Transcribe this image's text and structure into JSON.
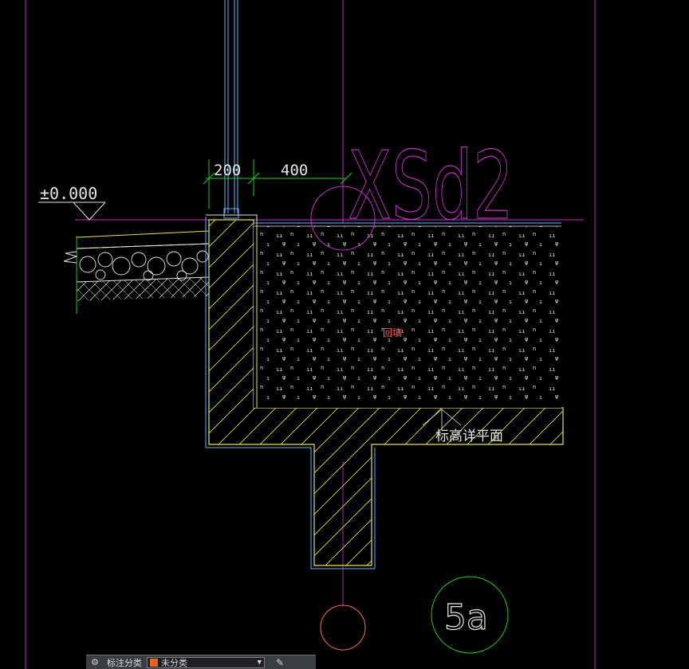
{
  "drawing": {
    "elevation_label": "±0.000",
    "dim_left": "200",
    "dim_right": "400",
    "section_tag": "XSd2",
    "backfill_label": "回填",
    "elevation_note": "标高详平面",
    "detail_number": "5a"
  },
  "statusbar": {
    "label": "标注分类",
    "selected_value": "未分类",
    "swatch_color": "#e8641e"
  },
  "colors": {
    "background": "#000000",
    "magenta": "#c832c8",
    "green": "#22c822",
    "yellow": "#e6e650",
    "cyan": "#64b4ff",
    "white": "#e6e6e6",
    "red": "#ff5a5a"
  }
}
